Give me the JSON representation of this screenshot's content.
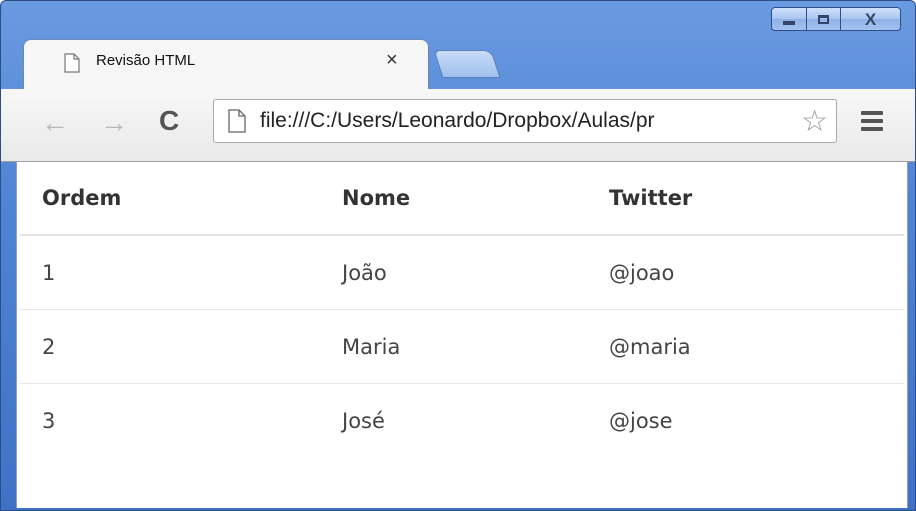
{
  "tab": {
    "title": "Revisão HTML",
    "close_glyph": "×",
    "icon": "page-icon"
  },
  "window": {
    "close_glyph": "X"
  },
  "toolbar": {
    "back_glyph": "←",
    "forward_glyph": "→",
    "reload_glyph": "C",
    "url": "file:///C:/Users/Leonardo/Dropbox/Aulas/pr",
    "star_glyph": "☆"
  },
  "table": {
    "headers": [
      "Ordem",
      "Nome",
      "Twitter"
    ],
    "rows": [
      [
        "1",
        "João",
        "@joao"
      ],
      [
        "2",
        "Maria",
        "@maria"
      ],
      [
        "3",
        "José",
        "@jose"
      ]
    ]
  },
  "colors": {
    "titlebar": "#4f83d4",
    "tab_bg": "#f6f6f6"
  }
}
